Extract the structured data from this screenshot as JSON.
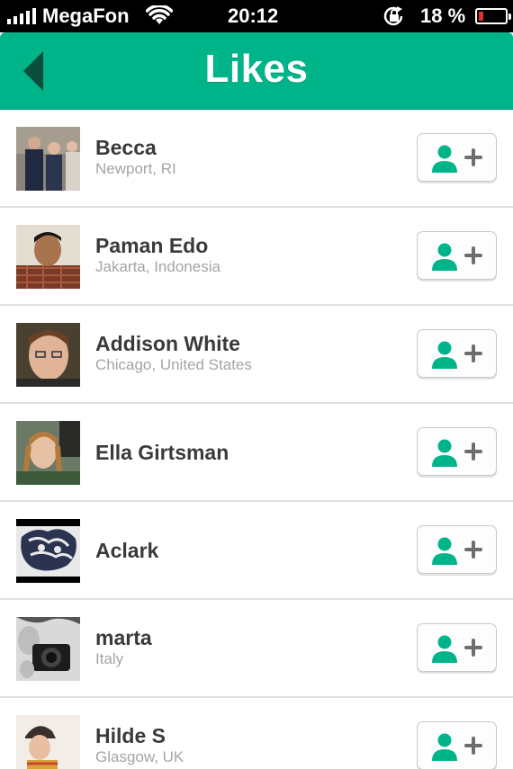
{
  "status_bar": {
    "carrier": "MegaFon",
    "time": "20:12",
    "battery_percent": "18 %",
    "battery_level": 0.18,
    "battery_color": "#e0302a"
  },
  "nav": {
    "title": "Likes",
    "back_icon": "back-arrow-icon",
    "accent": "#00b489"
  },
  "users": [
    {
      "name": "Becca",
      "location": "Newport, RI",
      "avatar": "photo-group"
    },
    {
      "name": "Paman Edo",
      "location": "Jakarta, Indonesia",
      "avatar": "photo-man"
    },
    {
      "name": "Addison White",
      "location": "Chicago, United States",
      "avatar": "photo-man-glasses"
    },
    {
      "name": "Ella Girtsman",
      "location": "",
      "avatar": "photo-girl"
    },
    {
      "name": "Aclark",
      "location": "",
      "avatar": "photo-art"
    },
    {
      "name": "marta",
      "location": "Italy",
      "avatar": "photo-camera-bw"
    },
    {
      "name": "Hilde S",
      "location": "Glasgow, UK",
      "avatar": "photo-woman-hat"
    }
  ],
  "follow_button_icon": "add-user-icon"
}
